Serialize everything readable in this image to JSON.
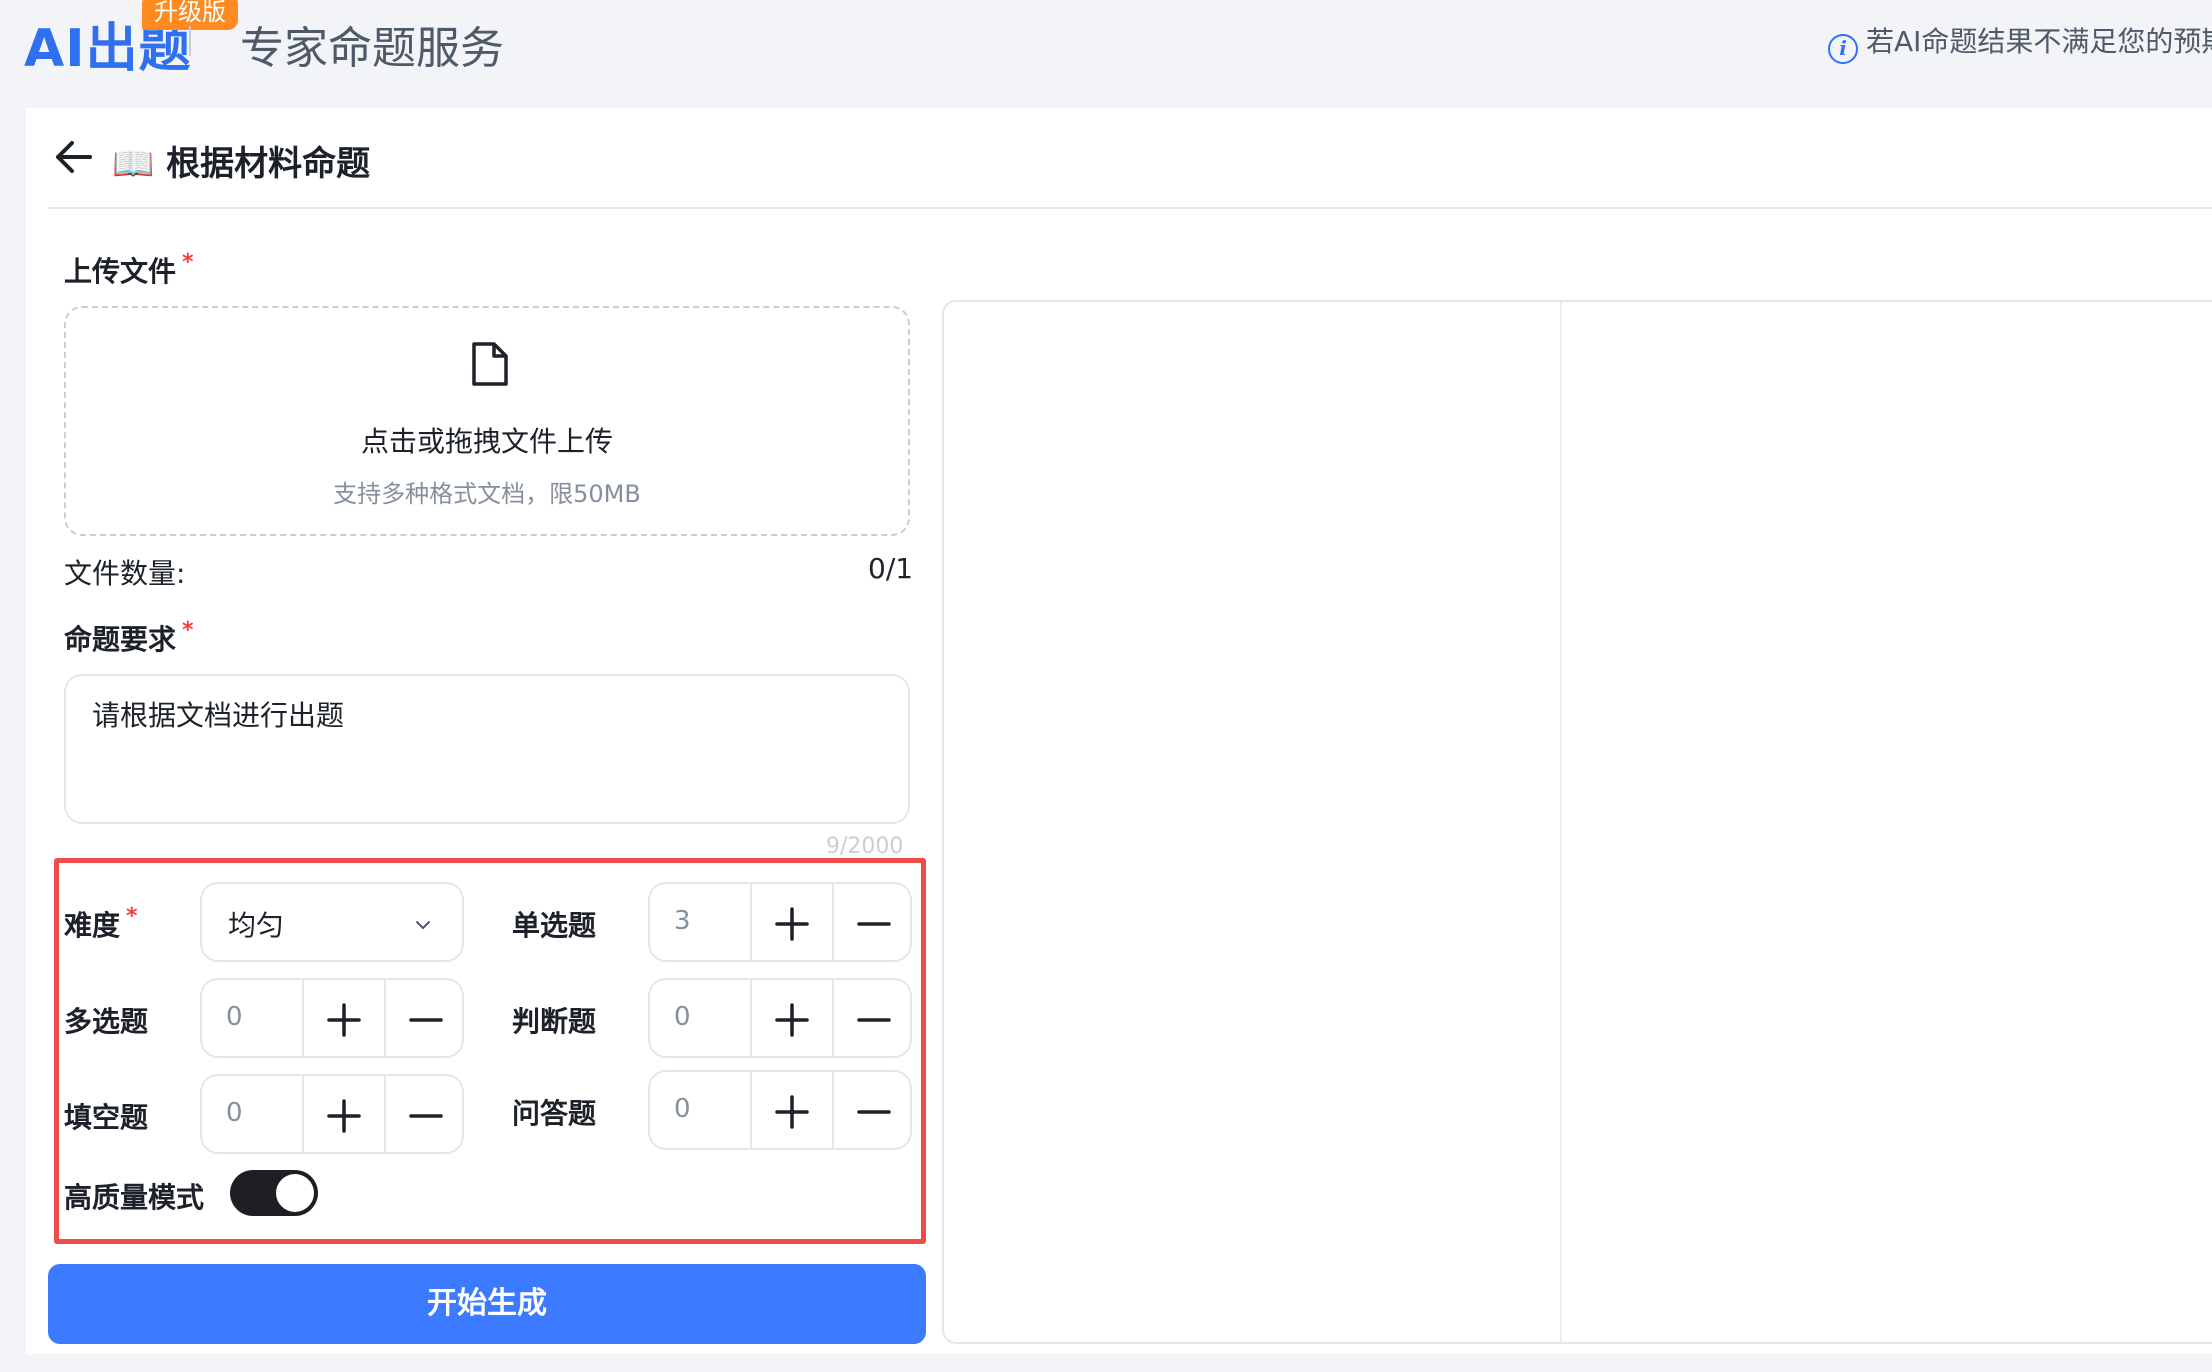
{
  "header": {
    "brand": "AI出题",
    "badge": "升级版",
    "subtitle": "专家命题服务",
    "notice_icon": "info-icon",
    "notice": "若AI命题结果不满足您的预期"
  },
  "page": {
    "title": "📖 根据材料命题",
    "back_icon": "arrow-left-icon"
  },
  "upload": {
    "label": "上传文件",
    "required_mark": "*",
    "icon": "file-icon",
    "main_text": "点击或拖拽文件上传",
    "hint_text": "支持多种格式文档，限50MB",
    "count_label": "文件数量:",
    "count_value": "0/1"
  },
  "requirement": {
    "label": "命题要求",
    "required_mark": "*",
    "value": "请根据文档进行出题",
    "char_count": "9/2000"
  },
  "options": {
    "difficulty_label": "难度",
    "difficulty_required": "*",
    "difficulty_value": "均匀",
    "single_choice_label": "单选题",
    "single_choice_value": "3",
    "multi_choice_label": "多选题",
    "multi_choice_value": "0",
    "true_false_label": "判断题",
    "true_false_value": "0",
    "fill_blank_label": "填空题",
    "fill_blank_value": "0",
    "qa_label": "问答题",
    "qa_value": "0",
    "high_quality_label": "高质量模式",
    "high_quality_on": true
  },
  "actions": {
    "generate_label": "开始生成"
  },
  "colors": {
    "brand": "#2f6ff0",
    "badge": "#ff8a1f",
    "primary_button": "#3c7bff",
    "highlight_border": "#ef4b4b",
    "required": "#f53f3f"
  }
}
